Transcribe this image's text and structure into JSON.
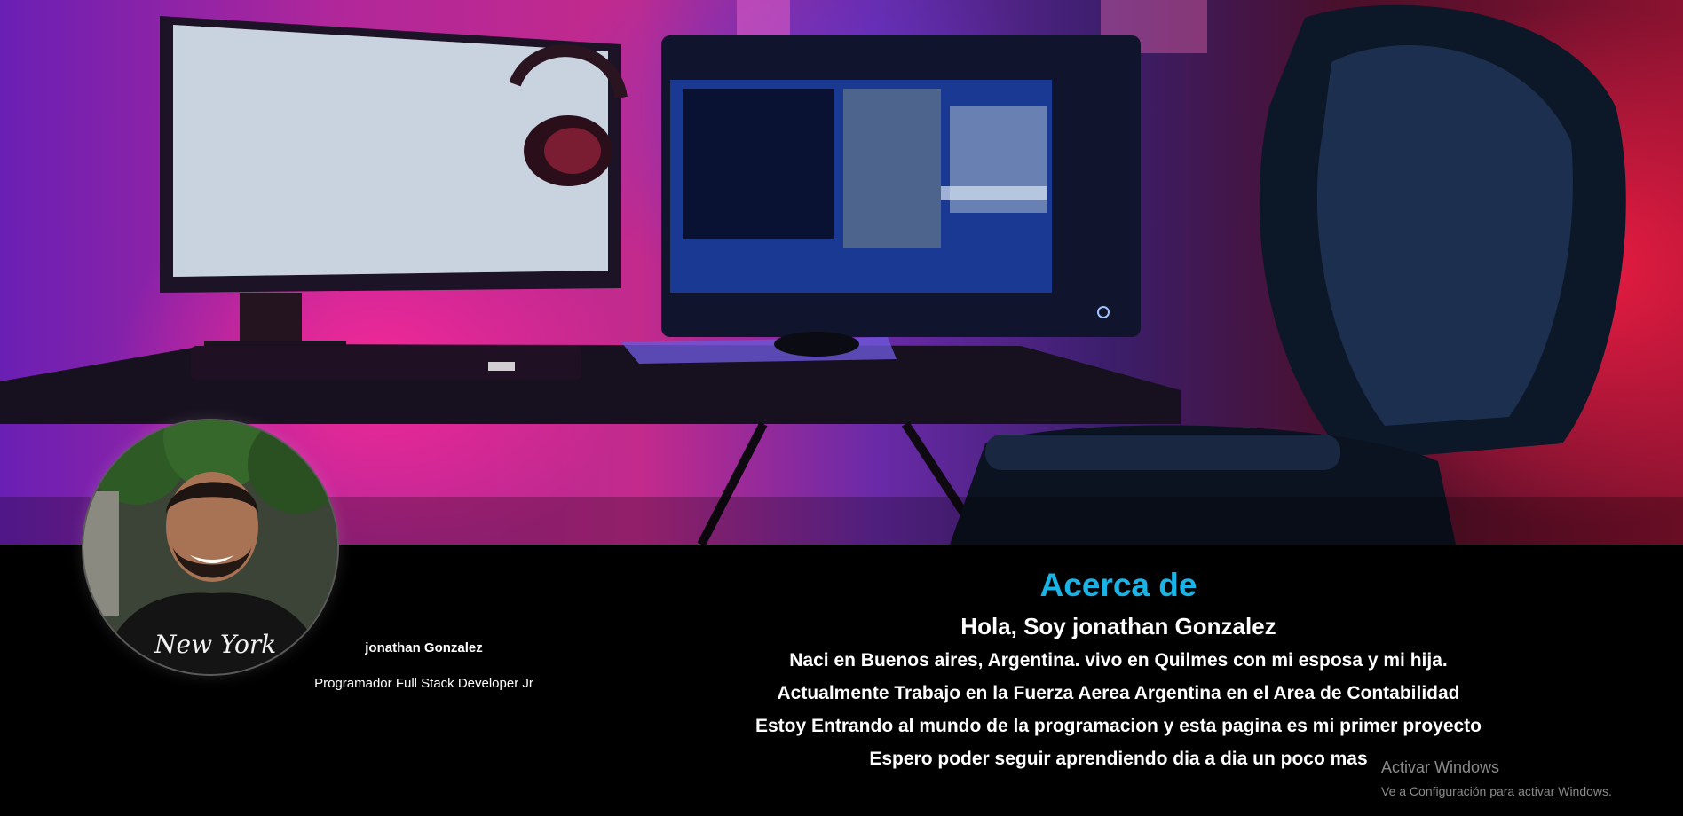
{
  "hero": {
    "image": "gaming-desk-setup-photo",
    "accent_colors": [
      "#b1279a",
      "#6a1fb4",
      "#8c1230",
      "#1ab3e6"
    ]
  },
  "profile": {
    "avatar": "profile-photo",
    "name": "jonathan Gonzalez",
    "role": "Programador Full Stack Developer Jr"
  },
  "about": {
    "title": "Acerca de",
    "greeting": "Hola, Soy jonathan Gonzalez",
    "lines": [
      "Naci en Buenos aires, Argentina. vivo en Quilmes con mi esposa y mi hija.",
      "Actualmente Trabajo en la Fuerza Aerea Argentina en el Area de Contabilidad",
      "Estoy Entrando al mundo de la programacion y esta pagina es mi primer proyecto",
      "Espero poder seguir aprendiendo dia a dia un poco mas"
    ],
    "title_color": "#1ab3e6"
  },
  "watermark": {
    "title": "Activar Windows",
    "subtitle": "Ve a Configuración para activar Windows."
  }
}
